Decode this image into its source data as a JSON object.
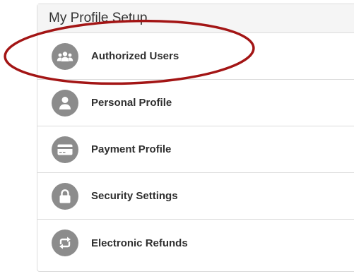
{
  "panel": {
    "title": "My Profile Setup"
  },
  "menu": {
    "items": [
      {
        "label": "Authorized Users",
        "icon": "users-icon"
      },
      {
        "label": "Personal Profile",
        "icon": "person-icon"
      },
      {
        "label": "Payment Profile",
        "icon": "credit-card-icon"
      },
      {
        "label": "Security Settings",
        "icon": "lock-icon"
      },
      {
        "label": "Electronic Refunds",
        "icon": "refresh-arrows-icon"
      }
    ]
  },
  "colors": {
    "icon_circle": "#8c8c8c",
    "highlight_ellipse": "#a31515",
    "header_background": "#f5f5f5",
    "border": "#dcdcdc"
  },
  "annotation": {
    "highlighted_item": "Authorized Users"
  }
}
